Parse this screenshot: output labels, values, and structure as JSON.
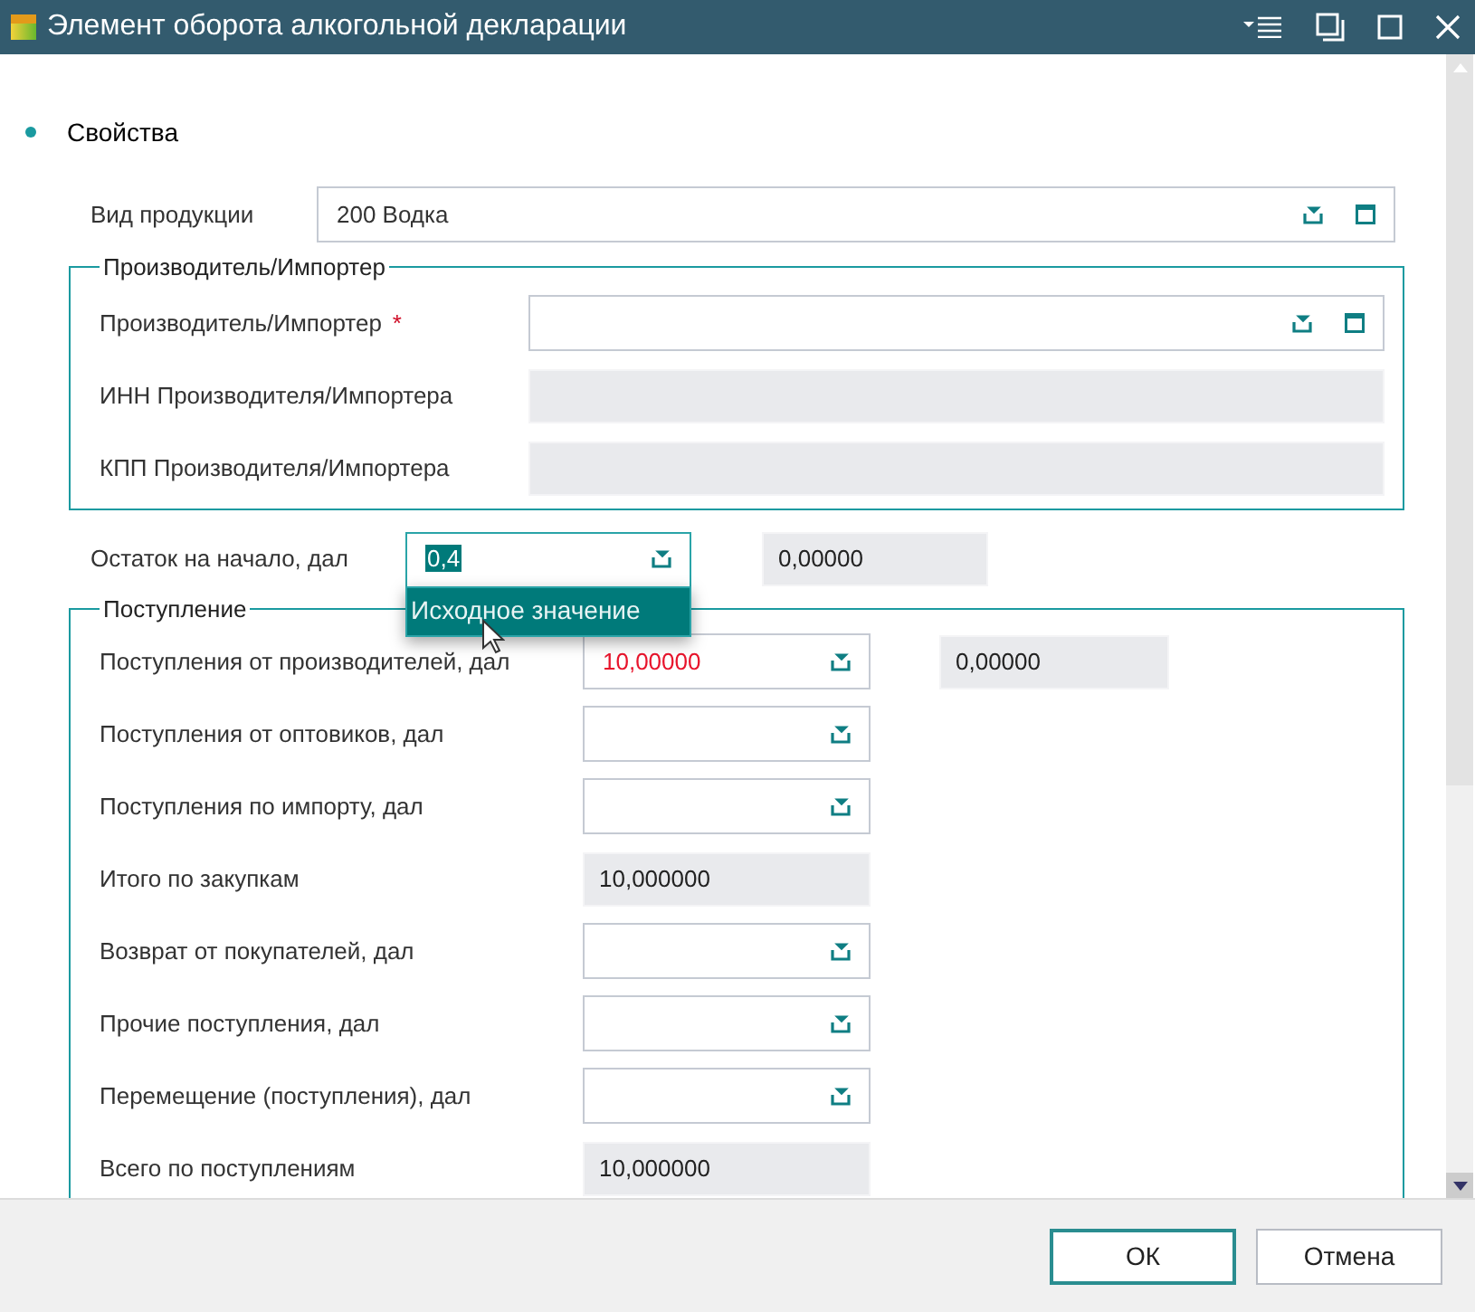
{
  "window": {
    "title": "Элемент оборота алкогольной декларации"
  },
  "section": {
    "title": "Свойства"
  },
  "product": {
    "label": "Вид продукции",
    "value": "200 Водка"
  },
  "producer_group": {
    "title": "Производитель/Импортер",
    "rows": [
      {
        "label": "Производитель/Импортер",
        "kind": "lookup",
        "required_mark": "*"
      },
      {
        "label": "ИНН Производителя/Импортера",
        "kind": "readonly"
      },
      {
        "label": "КПП Производителя/Импортера",
        "kind": "readonly"
      }
    ]
  },
  "opening_balance": {
    "label": "Остаток на начало, дал",
    "value": "0,4",
    "text_selected": true,
    "original": "0,00000",
    "popup": {
      "item": "Исходное значение"
    }
  },
  "receipts_group": {
    "title": "Поступление",
    "rows": [
      {
        "label": "Поступления от производителей, дал",
        "kind": "combo",
        "value": "10,00000",
        "modified": true,
        "original": "0,00000"
      },
      {
        "label": "Поступления от оптовиков, дал",
        "kind": "combo"
      },
      {
        "label": "Поступления по импорту, дал",
        "kind": "combo"
      },
      {
        "label": "Итого по закупкам",
        "kind": "readonly",
        "value": "10,000000"
      },
      {
        "label": "Возврат от покупателей, дал",
        "kind": "combo"
      },
      {
        "label": "Прочие поступления, дал",
        "kind": "combo"
      },
      {
        "label": "Перемещение (поступления), дал",
        "kind": "combo"
      },
      {
        "label": "Всего по поступлениям",
        "kind": "readonly",
        "value": "10,000000"
      }
    ]
  },
  "buttons": [
    {
      "label": "ОК",
      "kind": "default"
    },
    {
      "label": "Отмена",
      "kind": "normal"
    }
  ]
}
